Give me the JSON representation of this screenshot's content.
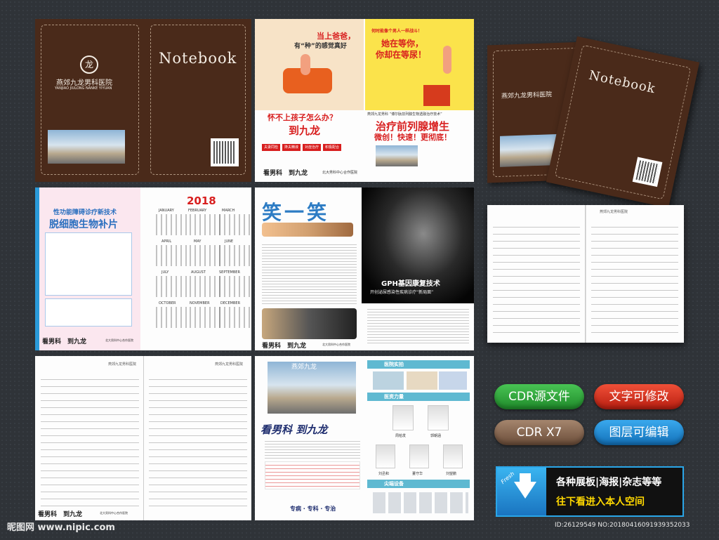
{
  "cover": {
    "hospital_cn": "燕郊九龙男科医院",
    "hospital_en": "YANJIAO JIULONG NANKE YIYUAN",
    "logo_glyph": "龙",
    "notebook": "Notebook"
  },
  "promo": {
    "line1a": "当上爸爸，",
    "line1b": "有“种”的感觉真好",
    "line2a": "何时能像个男人一样战斗！",
    "line2b": "她在等你，",
    "line2c": "你却在等尿！",
    "q1": "怀不上孩子怎么办？",
    "q2": "到九龙",
    "prostate_tech": "燕郊九龙男科 “博尔肽前列腺生物透融治疗技术”",
    "prostate_title": "治疗前列腺增生",
    "prostate_sub": "微创！快速！更彻底！",
    "tags": [
      "夫妻同检",
      "搀夫精液",
      "对症治疗",
      "积极配合"
    ],
    "footer_left": "看男科　到九龙",
    "footer_right": "北大男科中心合作医院"
  },
  "page3": {
    "title1": "性功能障碍诊疗新技术",
    "title2": "脱细胞生物补片",
    "footer_left": "看男科　到九龙",
    "footer_right": "北大男科中心合作医院"
  },
  "calendar": {
    "year": "2018",
    "months": [
      "JANUARY",
      "FEBRUARY",
      "MARCH",
      "APRIL",
      "MAY",
      "JUNE",
      "JULY",
      "AUGUST",
      "SEPTEMBER",
      "OCTOBER",
      "NOVEMBER",
      "DECEMBER"
    ]
  },
  "page5": {
    "banner": "笑一笑",
    "footer_left": "看男科　到九龙",
    "footer_right": "北大男科中心合作医院"
  },
  "gph": {
    "title": "GPH基因康复技术",
    "subtitle": "开创泌尿感染性疾病诊疗“新局面”"
  },
  "page7": {
    "sign": "燕郊九龙",
    "slogan": "看男科 到九龙",
    "bottom": "专病 · 专科 · 专治",
    "section1": "医院实拍",
    "section2": "医资力量",
    "section3": "尖端设备",
    "doctors": [
      "周柏发",
      "郭朝涵",
      "刘丞和",
      "董守华",
      "刘望鹏"
    ]
  },
  "page_footer": {
    "left": "看男科　到九龙",
    "right": "北大男科中心合作医院"
  },
  "buttons": {
    "cdr_source": "CDR源文件",
    "text_edit": "文字可修改",
    "cdr_x7": "CDR  X7",
    "layer_edit": "图层可编辑"
  },
  "ad": {
    "fresh": "Fresh",
    "line1": "各种展板|海报|杂志等等",
    "line2": "往下看进入本人空间"
  },
  "watermark": {
    "site": "昵图网 www.nipic.com",
    "id": "ID:26129549 NO:20180416091939352033"
  },
  "colors": {
    "cover_brown": "#4a2a1a",
    "btn_green": "#2fae3a",
    "btn_red": "#e0331f",
    "btn_brown": "#8a6a55",
    "btn_blue": "#1e8fd8",
    "accent_red": "#d81e1e"
  }
}
